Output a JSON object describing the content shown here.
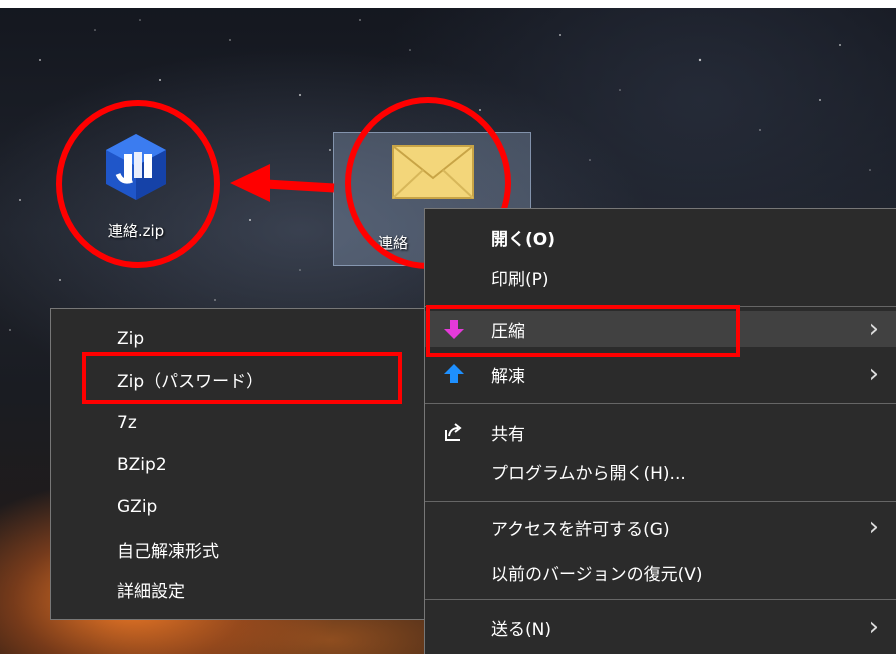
{
  "desktop": {
    "zip_file": {
      "label": "連絡.zip"
    },
    "mail_file": {
      "label": "連絡"
    }
  },
  "context_menu": {
    "items": [
      {
        "label": "開く(O)",
        "bold": true
      },
      {
        "label": "印刷(P)"
      },
      {
        "label": "圧縮",
        "icon": "pink-down-arrow-icon",
        "has_submenu": true
      },
      {
        "label": "解凍",
        "icon": "blue-up-arrow-icon",
        "has_submenu": true
      },
      {
        "label": "共有",
        "icon": "share-icon"
      },
      {
        "label": "プログラムから開く(H)..."
      },
      {
        "label": "アクセスを許可する(G)",
        "has_submenu": true
      },
      {
        "label": "以前のバージョンの復元(V)"
      },
      {
        "label": "送る(N)",
        "has_submenu": true
      }
    ]
  },
  "submenu": {
    "items": [
      {
        "label": "Zip"
      },
      {
        "label": "Zip（パスワード）"
      },
      {
        "label": "7z"
      },
      {
        "label": "BZip2"
      },
      {
        "label": "GZip"
      },
      {
        "label": "自己解凍形式"
      },
      {
        "label": "詳細設定"
      }
    ]
  },
  "colors": {
    "annotation_red": "#ff0000",
    "menu_bg": "#2b2b2b",
    "highlight_bg": "#414141",
    "compress_arrow": "#e53ad9",
    "extract_arrow": "#1e90ff"
  }
}
